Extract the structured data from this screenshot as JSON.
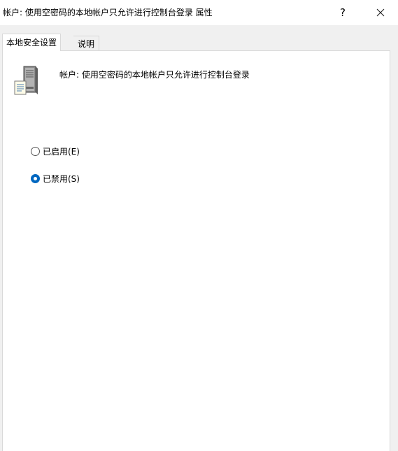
{
  "window": {
    "title": "帐户: 使用空密码的本地帐户只允许进行控制台登录 属性",
    "help_label": "?",
    "close_icon": "close-icon"
  },
  "tabs": [
    {
      "label": "本地安全设置",
      "active": true
    },
    {
      "label": "说明",
      "active": false
    }
  ],
  "policy": {
    "icon": "server-policy-icon",
    "name": "帐户: 使用空密码的本地帐户只允许进行控制台登录"
  },
  "options": [
    {
      "label": "已启用(E)",
      "selected": false
    },
    {
      "label": "已禁用(S)",
      "selected": true
    }
  ],
  "colors": {
    "accent": "#0067c0",
    "titlebar": "#ffffff",
    "dialog_background": "#f0f0f0",
    "panel": "#ffffff"
  }
}
